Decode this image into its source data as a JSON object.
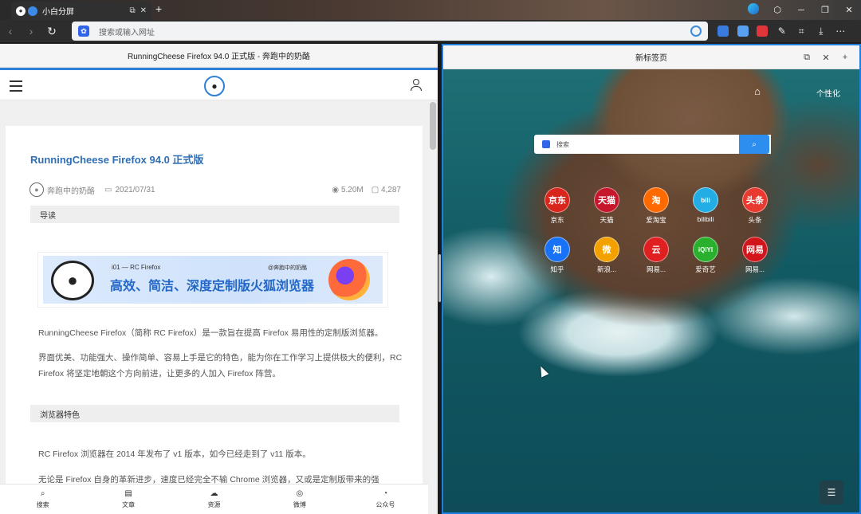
{
  "browser": {
    "tab": {
      "title": "小白分屏"
    },
    "address_bar": {
      "placeholder": "搜索或输入网址"
    }
  },
  "left_pane": {
    "title": "RunningCheese Firefox 94.0 正式版 - 奔跑中的奶酪",
    "article": {
      "title": "RunningCheese Firefox 94.0 正式版",
      "author": "奔跑中的奶酪",
      "date": "2021/07/31",
      "views": "5.20M",
      "comments": "4,287",
      "section1": "导读",
      "banner": {
        "small": "i01 — RC Firefox",
        "big": "高效、简洁、深度定制版火狐浏览器",
        "right": "@奔跑中的奶酪"
      },
      "para1": "RunningCheese Firefox（简称 RC Firefox）是一款旨在提高 Firefox 易用性的定制版浏览器。",
      "para2": "界面优美、功能强大、操作简单、容易上手是它的特色，能为你在工作学习上提供极大的便利，RC Firefox 将坚定地朝这个方向前进，让更多的人加入 Firefox 阵营。",
      "section2": "浏览器特色",
      "para3": "RC Firefox 浏览器在 2014 年发布了 v1 版本，如今已经走到了 v11 版本。",
      "para4": "无论是 Firefox 自身的革新进步，速度已经完全不输 Chrome 浏览器，又或是定制版带来的强"
    },
    "bottom_nav": [
      {
        "label": "搜索",
        "icon": "search-icon"
      },
      {
        "label": "文章",
        "icon": "document-icon"
      },
      {
        "label": "资源",
        "icon": "cloud-icon"
      },
      {
        "label": "微博",
        "icon": "weibo-icon"
      },
      {
        "label": "公众号",
        "icon": "wechat-icon"
      }
    ]
  },
  "right_pane": {
    "title": "新标签页",
    "customize_label": "个性化",
    "search_placeholder": "搜索",
    "sites": [
      {
        "label": "京东",
        "glyph": "京东",
        "color": "#d9261c"
      },
      {
        "label": "天猫",
        "glyph": "天猫",
        "color": "#c7172d"
      },
      {
        "label": "爱淘宝",
        "glyph": "淘",
        "color": "#ff6a00"
      },
      {
        "label": "bilibili",
        "glyph": "bili",
        "color": "#23ade5"
      },
      {
        "label": "头条",
        "glyph": "头条",
        "color": "#e83a30"
      },
      {
        "label": "知乎",
        "glyph": "知",
        "color": "#1772f6"
      },
      {
        "label": "新浪...",
        "glyph": "微",
        "color": "#f3a100"
      },
      {
        "label": "网易...",
        "glyph": "云",
        "color": "#e02020"
      },
      {
        "label": "爱奇艺",
        "glyph": "iQIYI",
        "color": "#29b12e"
      },
      {
        "label": "网易...",
        "glyph": "网易",
        "color": "#d2151b"
      }
    ]
  }
}
